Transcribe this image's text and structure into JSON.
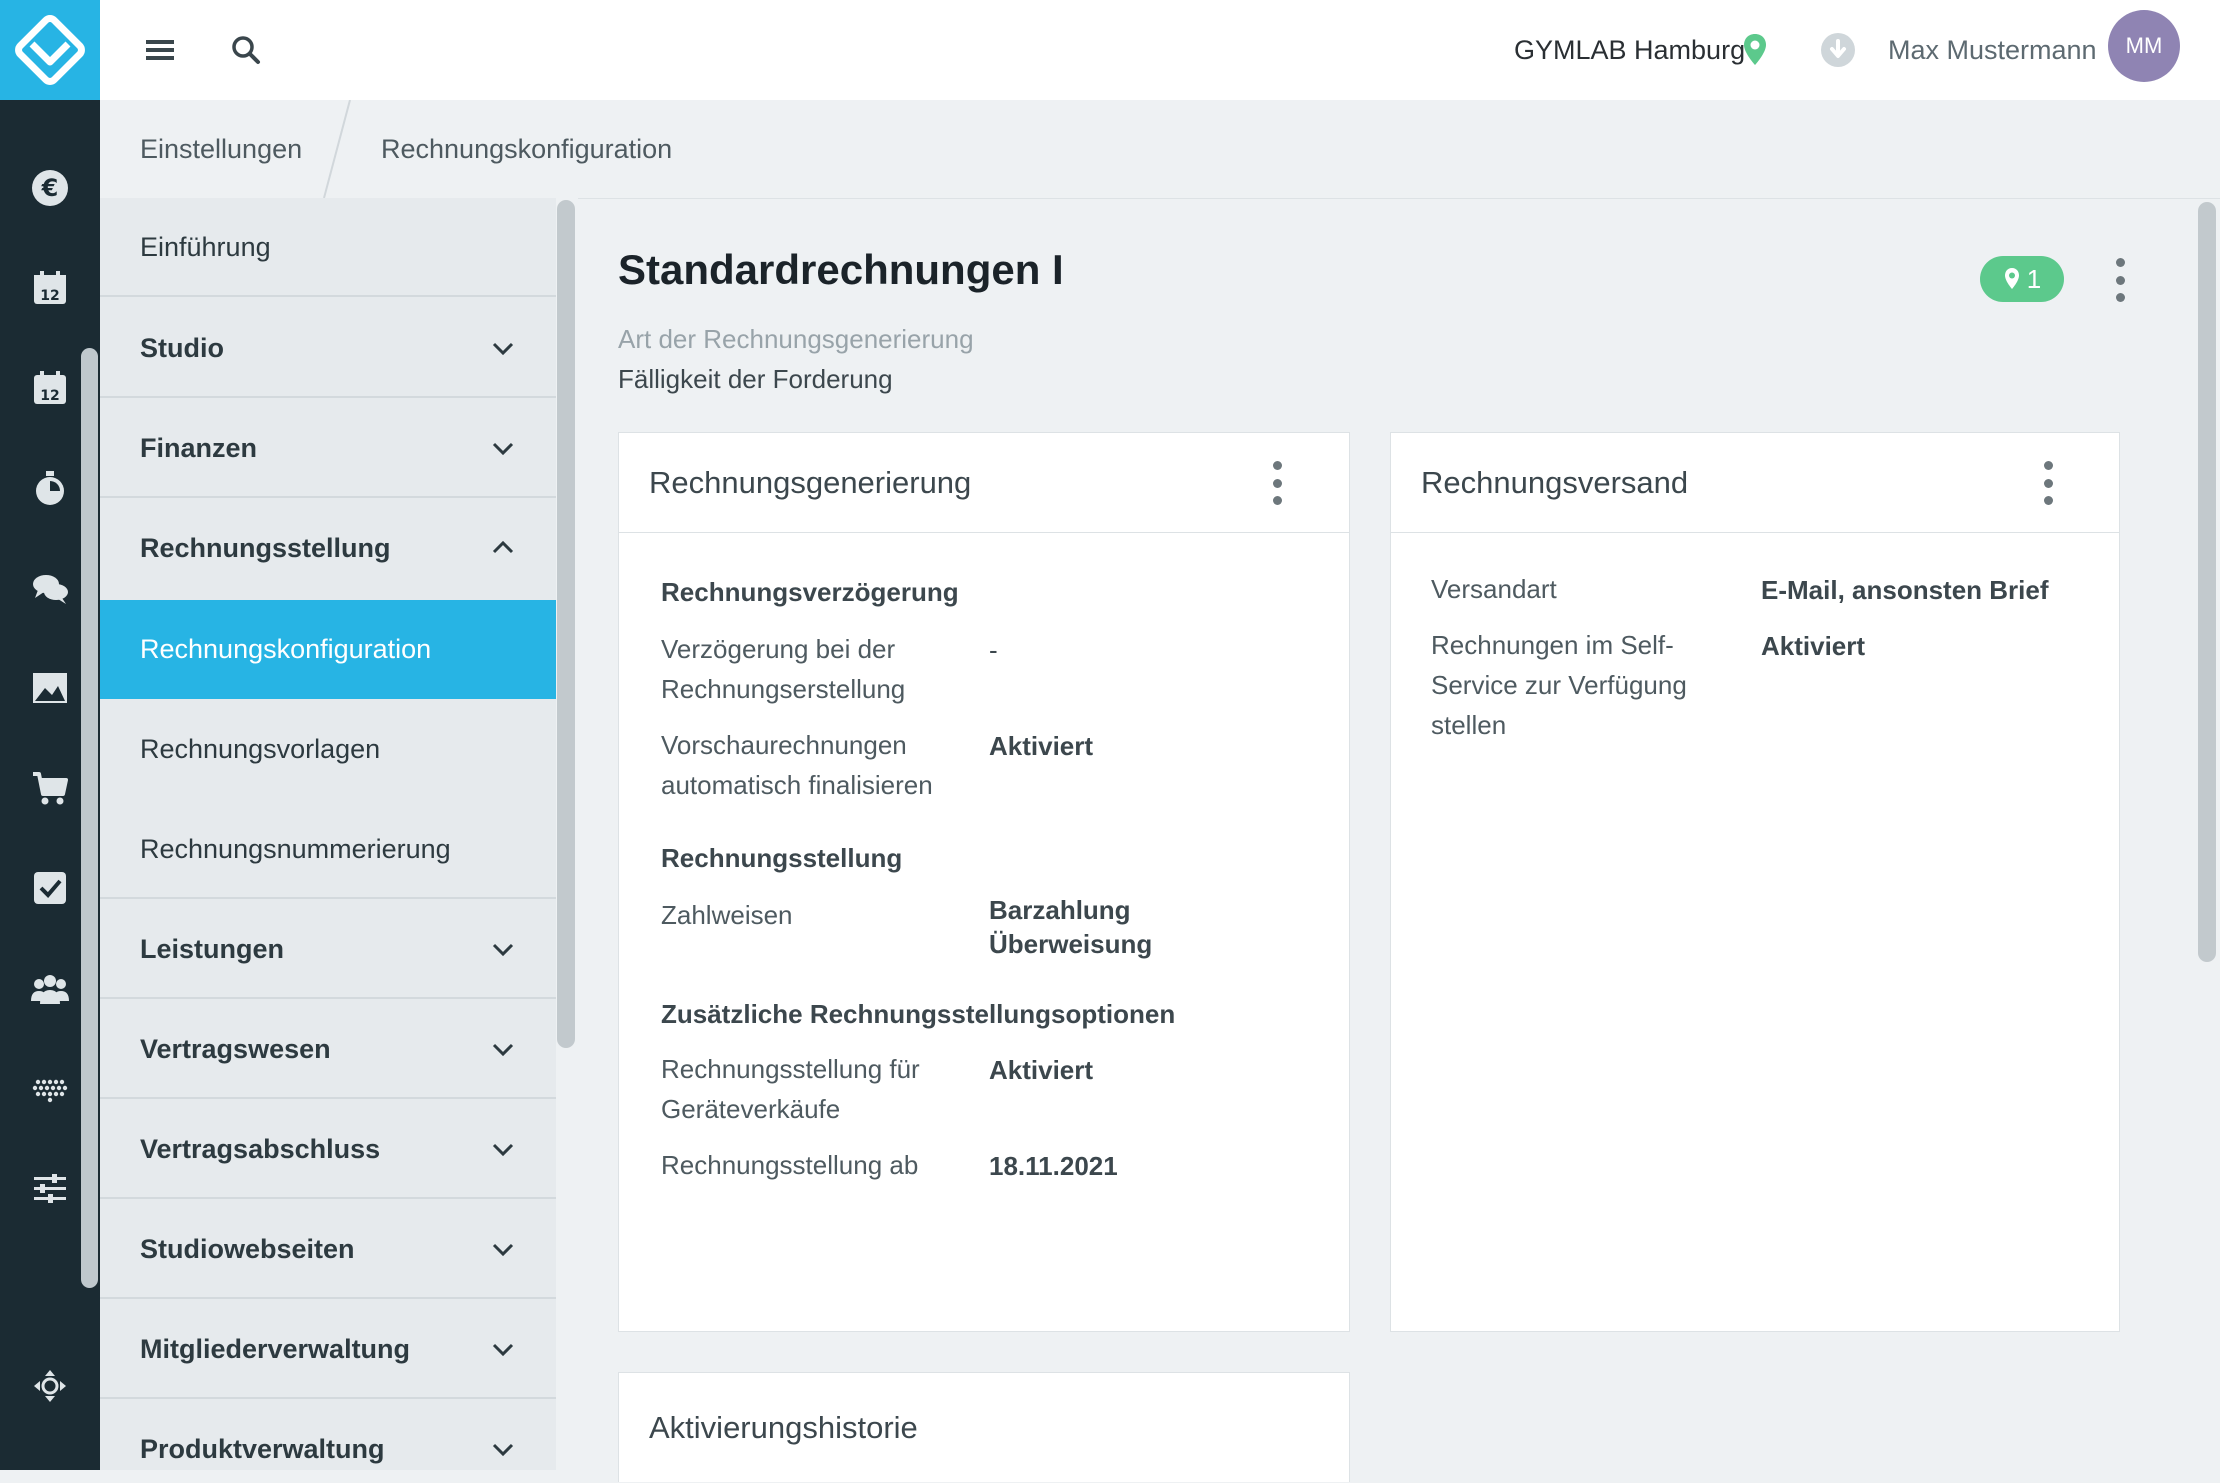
{
  "topbar": {
    "studio": "GYMLAB Hamburg",
    "user_name": "Max Mustermann",
    "avatar_initials": "MM"
  },
  "breadcrumb": [
    "Einstellungen",
    "Rechnungskonfiguration"
  ],
  "nav": {
    "items": [
      {
        "label": "Einführung"
      },
      {
        "label": "Studio"
      },
      {
        "label": "Finanzen"
      },
      {
        "label": "Rechnungsstellung"
      },
      {
        "label": "Rechnungskonfiguration"
      },
      {
        "label": "Rechnungsvorlagen"
      },
      {
        "label": "Rechnungsnummerierung"
      },
      {
        "label": "Leistungen"
      },
      {
        "label": "Vertragswesen"
      },
      {
        "label": "Vertragsabschluss"
      },
      {
        "label": "Studiowebseiten"
      },
      {
        "label": "Mitgliederverwaltung"
      },
      {
        "label": "Produktverwaltung"
      }
    ]
  },
  "main": {
    "title": "Standardrechnungen I",
    "subtitle_1": "Art der Rechnungsgenerierung",
    "subtitle_2": "Fälligkeit der Forderung",
    "location_badge_count": "1",
    "card_generation": {
      "title": "Rechnungsgenerierung",
      "section_1": "Rechnungsverzögerung",
      "rows_1": [
        {
          "label": "Verzögerung bei der Rechnungserstellung",
          "value": "-"
        },
        {
          "label": "Vorschaurechnungen automatisch finalisieren",
          "value": "Aktiviert"
        }
      ],
      "section_2": "Rechnungsstellung",
      "rows_2": [
        {
          "label": "Zahlweisen",
          "value_1": "Barzahlung",
          "value_2": "Überweisung"
        }
      ],
      "section_3": "Zusätzliche Rechnungsstellungsoptionen",
      "rows_3": [
        {
          "label": "Rechnungsstellung für Geräteverkäufe",
          "value": "Aktiviert"
        },
        {
          "label": "Rechnungsstellung ab",
          "value": "18.11.2021"
        }
      ]
    },
    "card_dispatch": {
      "title": "Rechnungsversand",
      "rows": [
        {
          "label": "Versandart",
          "value": "E-Mail, ansonsten Brief"
        },
        {
          "label": "Rechnungen im Self-Service zur Verfügung stellen",
          "value": "Aktiviert"
        }
      ]
    },
    "card_history": {
      "title": "Aktivierungshistorie"
    }
  },
  "colors": {
    "rail": "#1b2b33",
    "accent": "#27b4e4",
    "badge": "#5cc98c",
    "avatar": "#8f84b3"
  }
}
